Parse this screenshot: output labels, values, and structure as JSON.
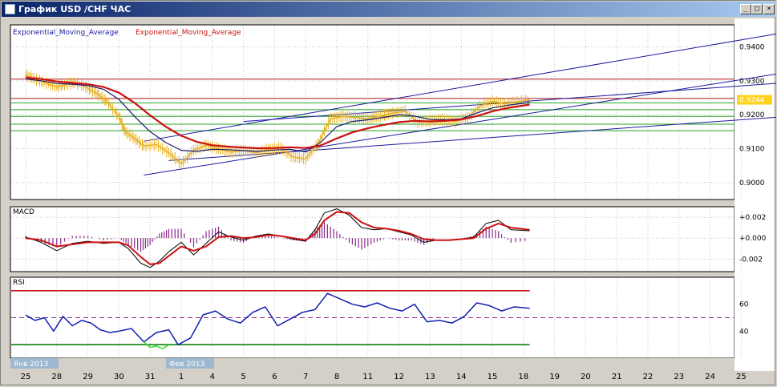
{
  "window": {
    "title": "График USD /CHF ЧАС",
    "title_icon": "chart-icon",
    "buttons": [
      {
        "name": "minimize-button",
        "glyph": "_"
      },
      {
        "name": "maximize-button",
        "glyph": "□"
      },
      {
        "name": "close-button",
        "glyph": "×"
      }
    ]
  },
  "colors": {
    "background": "#ffffff",
    "price": "#e8b020",
    "ema_fast": "#1a1a6e",
    "ema_slow": "#cc1111",
    "trend": "#1a1a9e",
    "level_red": "#b01010",
    "level_green": "#20a020",
    "macd_hist": "#8a2a8a",
    "rsi": "#1020b0",
    "rsi_low": "#30e030",
    "rsi_upper": "#cc1111",
    "rsi_lower": "#108010",
    "rsi_mid": "#8a2a8a",
    "current_price_bg": "#ffd21e"
  },
  "chart_data": [
    {
      "panel": "price",
      "type": "line",
      "legend": [
        "Exponential_Moving_Average",
        "Exponential_Moving_Average"
      ],
      "current_price_label": "0.9244",
      "ylim": [
        0.895,
        0.9465
      ],
      "yticks": [
        {
          "v": 0.94,
          "label": "0.9400"
        },
        {
          "v": 0.93,
          "label": "0.9300"
        },
        {
          "v": 0.92,
          "label": "0.9200"
        },
        {
          "v": 0.91,
          "label": "0.9100"
        },
        {
          "v": 0.9,
          "label": "0.9000"
        }
      ],
      "hlines": [
        {
          "v": 0.9305,
          "color": "level_red"
        },
        {
          "v": 0.9248,
          "color": "level_red"
        },
        {
          "v": 0.9235,
          "color": "level_green"
        },
        {
          "v": 0.9215,
          "color": "level_green"
        },
        {
          "v": 0.9195,
          "color": "level_green"
        },
        {
          "v": 0.9172,
          "color": "level_green"
        },
        {
          "v": 0.9153,
          "color": "level_green"
        }
      ],
      "trendlines": [
        {
          "x1": 3.8,
          "y1": 0.9122,
          "x2": 26.5,
          "y2": 0.9475
        },
        {
          "x1": 3.8,
          "y1": 0.9022,
          "x2": 26.5,
          "y2": 0.9355
        },
        {
          "x1": 4.6,
          "y1": 0.9065,
          "x2": 26.5,
          "y2": 0.9208
        },
        {
          "x1": 7.0,
          "y1": 0.918,
          "x2": 26.5,
          "y2": 0.9308
        }
      ],
      "price": {
        "x": [
          0,
          0.3,
          0.6,
          1.0,
          1.3,
          1.6,
          2.0,
          2.3,
          2.6,
          3.0,
          3.2,
          3.5,
          3.8,
          4.2,
          4.6,
          5.0,
          5.4,
          5.8,
          6.2,
          6.6,
          7.0,
          7.4,
          7.8,
          8.2,
          8.6,
          9.0,
          9.4,
          9.8,
          10.2,
          10.6,
          11.0,
          11.4,
          11.8,
          12.2,
          12.6,
          13.0,
          13.4,
          13.8,
          14.2,
          14.6,
          15.0,
          15.4,
          15.8,
          16.2
        ],
        "y": [
          0.9318,
          0.9305,
          0.9295,
          0.9282,
          0.929,
          0.9295,
          0.9278,
          0.9262,
          0.924,
          0.9195,
          0.915,
          0.913,
          0.9108,
          0.9112,
          0.9088,
          0.9055,
          0.9095,
          0.911,
          0.91,
          0.909,
          0.9095,
          0.9088,
          0.9098,
          0.9102,
          0.9075,
          0.907,
          0.9115,
          0.9188,
          0.9195,
          0.9192,
          0.9188,
          0.9196,
          0.9205,
          0.921,
          0.9178,
          0.9182,
          0.9186,
          0.918,
          0.919,
          0.9225,
          0.924,
          0.9232,
          0.9238,
          0.9244
        ]
      },
      "ema_fast": {
        "x": [
          0,
          0.5,
          1.0,
          1.5,
          2.0,
          2.5,
          3.0,
          3.5,
          4.0,
          4.5,
          5.0,
          5.5,
          6.0,
          6.5,
          7.0,
          7.5,
          8.0,
          8.5,
          9.0,
          9.5,
          10.0,
          10.5,
          11.0,
          11.5,
          12.0,
          12.5,
          13.0,
          13.5,
          14.0,
          14.5,
          15.0,
          15.5,
          16.2
        ],
        "y": [
          0.9305,
          0.93,
          0.9292,
          0.929,
          0.9286,
          0.9275,
          0.9245,
          0.9195,
          0.915,
          0.9118,
          0.9095,
          0.9092,
          0.9098,
          0.9097,
          0.9094,
          0.9092,
          0.9096,
          0.9098,
          0.909,
          0.912,
          0.9165,
          0.918,
          0.9185,
          0.9192,
          0.92,
          0.9196,
          0.9186,
          0.9185,
          0.9188,
          0.9205,
          0.922,
          0.9228,
          0.9236
        ]
      },
      "ema_slow": {
        "x": [
          0,
          0.5,
          1.0,
          1.5,
          2.0,
          2.5,
          3.0,
          3.5,
          4.0,
          4.5,
          5.0,
          5.5,
          6.0,
          6.5,
          7.0,
          7.5,
          8.0,
          8.5,
          9.0,
          9.5,
          10.0,
          10.5,
          11.0,
          11.5,
          12.0,
          12.5,
          13.0,
          13.5,
          14.0,
          14.5,
          15.0,
          15.5,
          16.2
        ],
        "y": [
          0.931,
          0.9305,
          0.9298,
          0.9294,
          0.929,
          0.9282,
          0.9265,
          0.9235,
          0.9198,
          0.9165,
          0.9138,
          0.912,
          0.911,
          0.9106,
          0.9103,
          0.9101,
          0.9102,
          0.9104,
          0.9102,
          0.911,
          0.913,
          0.9148,
          0.916,
          0.917,
          0.9178,
          0.9182,
          0.918,
          0.9182,
          0.9186,
          0.9196,
          0.921,
          0.922,
          0.923
        ]
      }
    },
    {
      "panel": "macd",
      "type": "line",
      "label": "MACD",
      "ylim": [
        -0.0032,
        0.003
      ],
      "yticks": [
        {
          "v": 0.002,
          "label": "+0.002"
        },
        {
          "v": 0.0,
          "label": "+0.000"
        },
        {
          "v": -0.002,
          "label": "-0.002"
        }
      ],
      "macd": {
        "x": [
          0,
          0.5,
          1.0,
          1.5,
          2.0,
          2.5,
          3.0,
          3.3,
          3.7,
          4.0,
          4.3,
          4.6,
          5.0,
          5.4,
          5.8,
          6.2,
          6.6,
          7.0,
          7.4,
          7.8,
          8.2,
          8.6,
          9.0,
          9.3,
          9.6,
          10.0,
          10.4,
          10.8,
          11.2,
          11.6,
          12.0,
          12.4,
          12.8,
          13.2,
          13.6,
          14.0,
          14.4,
          14.8,
          15.2,
          15.6,
          16.2
        ],
        "y": [
          0.0001,
          -0.0004,
          -0.0012,
          -0.0005,
          -0.0003,
          -0.0005,
          -0.0004,
          -0.001,
          -0.0024,
          -0.0028,
          -0.0022,
          -0.0013,
          -0.0004,
          -0.0016,
          -0.0005,
          0.0006,
          0.0001,
          -0.0002,
          0.0002,
          0.0004,
          0.0002,
          -0.0001,
          -0.0003,
          0.0008,
          0.0024,
          0.0028,
          0.0022,
          0.001,
          0.0008,
          0.0009,
          0.0006,
          0.0003,
          -0.0004,
          -0.0002,
          -0.0002,
          -0.0001,
          0.0001,
          0.0014,
          0.0017,
          0.0008,
          0.0007
        ]
      },
      "signal": {
        "x": [
          0,
          0.5,
          1.0,
          1.5,
          2.0,
          2.5,
          3.0,
          3.3,
          3.7,
          4.0,
          4.3,
          4.6,
          5.0,
          5.4,
          5.8,
          6.2,
          6.6,
          7.0,
          7.4,
          7.8,
          8.2,
          8.6,
          9.0,
          9.3,
          9.6,
          10.0,
          10.4,
          10.8,
          11.2,
          11.6,
          12.0,
          12.4,
          12.8,
          13.2,
          13.6,
          14.0,
          14.4,
          14.8,
          15.2,
          15.6,
          16.2
        ],
        "y": [
          0.0,
          -0.0002,
          -0.0008,
          -0.0006,
          -0.0004,
          -0.0004,
          -0.0004,
          -0.0007,
          -0.0018,
          -0.0025,
          -0.0024,
          -0.0017,
          -0.0008,
          -0.0012,
          -0.0008,
          0.0001,
          0.0002,
          0.0,
          0.0001,
          0.0003,
          0.0002,
          0.0,
          -0.0002,
          0.0004,
          0.0017,
          0.0025,
          0.0024,
          0.0015,
          0.001,
          0.0009,
          0.0007,
          0.0004,
          -0.0001,
          -0.0002,
          -0.0002,
          -0.0001,
          0.0,
          0.0009,
          0.0014,
          0.001,
          0.0008
        ]
      }
    },
    {
      "panel": "rsi",
      "type": "line",
      "label": "RSI",
      "ylim": [
        20,
        80
      ],
      "yticks": [
        {
          "v": 60,
          "label": "60"
        },
        {
          "v": 40,
          "label": "40"
        }
      ],
      "levels": [
        {
          "v": 70,
          "color": "rsi_upper",
          "dash": false
        },
        {
          "v": 50,
          "color": "rsi_mid",
          "dash": true
        },
        {
          "v": 30,
          "color": "rsi_lower",
          "dash": false
        }
      ],
      "rsi": {
        "x": [
          0,
          0.3,
          0.6,
          0.9,
          1.2,
          1.5,
          1.8,
          2.1,
          2.4,
          2.7,
          3.0,
          3.4,
          3.8,
          4.2,
          4.6,
          4.9,
          5.3,
          5.7,
          6.1,
          6.5,
          6.9,
          7.3,
          7.7,
          8.1,
          8.5,
          8.9,
          9.3,
          9.7,
          10.1,
          10.5,
          10.9,
          11.3,
          11.7,
          12.1,
          12.5,
          12.9,
          13.3,
          13.7,
          14.1,
          14.5,
          14.9,
          15.3,
          15.7,
          16.2
        ],
        "y": [
          52,
          48,
          50,
          40,
          51,
          44,
          48,
          46,
          41,
          39,
          40,
          42,
          32,
          39,
          41,
          30,
          35,
          52,
          55,
          49,
          46,
          54,
          58,
          44,
          49,
          54,
          56,
          68,
          64,
          60,
          58,
          61,
          57,
          55,
          60,
          47,
          48,
          46,
          51,
          61,
          59,
          55,
          58,
          57
        ]
      },
      "rsi_low": {
        "x": [
          3.8,
          4.0,
          4.2,
          4.4,
          4.6
        ],
        "y": [
          32,
          28,
          29,
          27,
          30
        ]
      }
    }
  ],
  "xaxis": {
    "ticks": [
      {
        "x": 0,
        "label": "25"
      },
      {
        "x": 1,
        "label": "28"
      },
      {
        "x": 2,
        "label": "29"
      },
      {
        "x": 3,
        "label": "30"
      },
      {
        "x": 4,
        "label": "31"
      },
      {
        "x": 5,
        "label": "1"
      },
      {
        "x": 6,
        "label": "4"
      },
      {
        "x": 7,
        "label": "5"
      },
      {
        "x": 8,
        "label": "6"
      },
      {
        "x": 9,
        "label": "7"
      },
      {
        "x": 10,
        "label": "8"
      },
      {
        "x": 11,
        "label": "11"
      },
      {
        "x": 12,
        "label": "12"
      },
      {
        "x": 13,
        "label": "13"
      },
      {
        "x": 14,
        "label": "14"
      },
      {
        "x": 15,
        "label": "15"
      },
      {
        "x": 16,
        "label": "18"
      },
      {
        "x": 17,
        "label": "19"
      },
      {
        "x": 18,
        "label": "20"
      },
      {
        "x": 19,
        "label": "21"
      },
      {
        "x": 20,
        "label": "22"
      },
      {
        "x": 21,
        "label": "23"
      },
      {
        "x": 22,
        "label": "24"
      },
      {
        "x": 23,
        "label": "25"
      }
    ],
    "month_labels": [
      {
        "x": 0,
        "label": "Янв 2013"
      },
      {
        "x": 5,
        "label": "Фев 2013"
      }
    ]
  }
}
